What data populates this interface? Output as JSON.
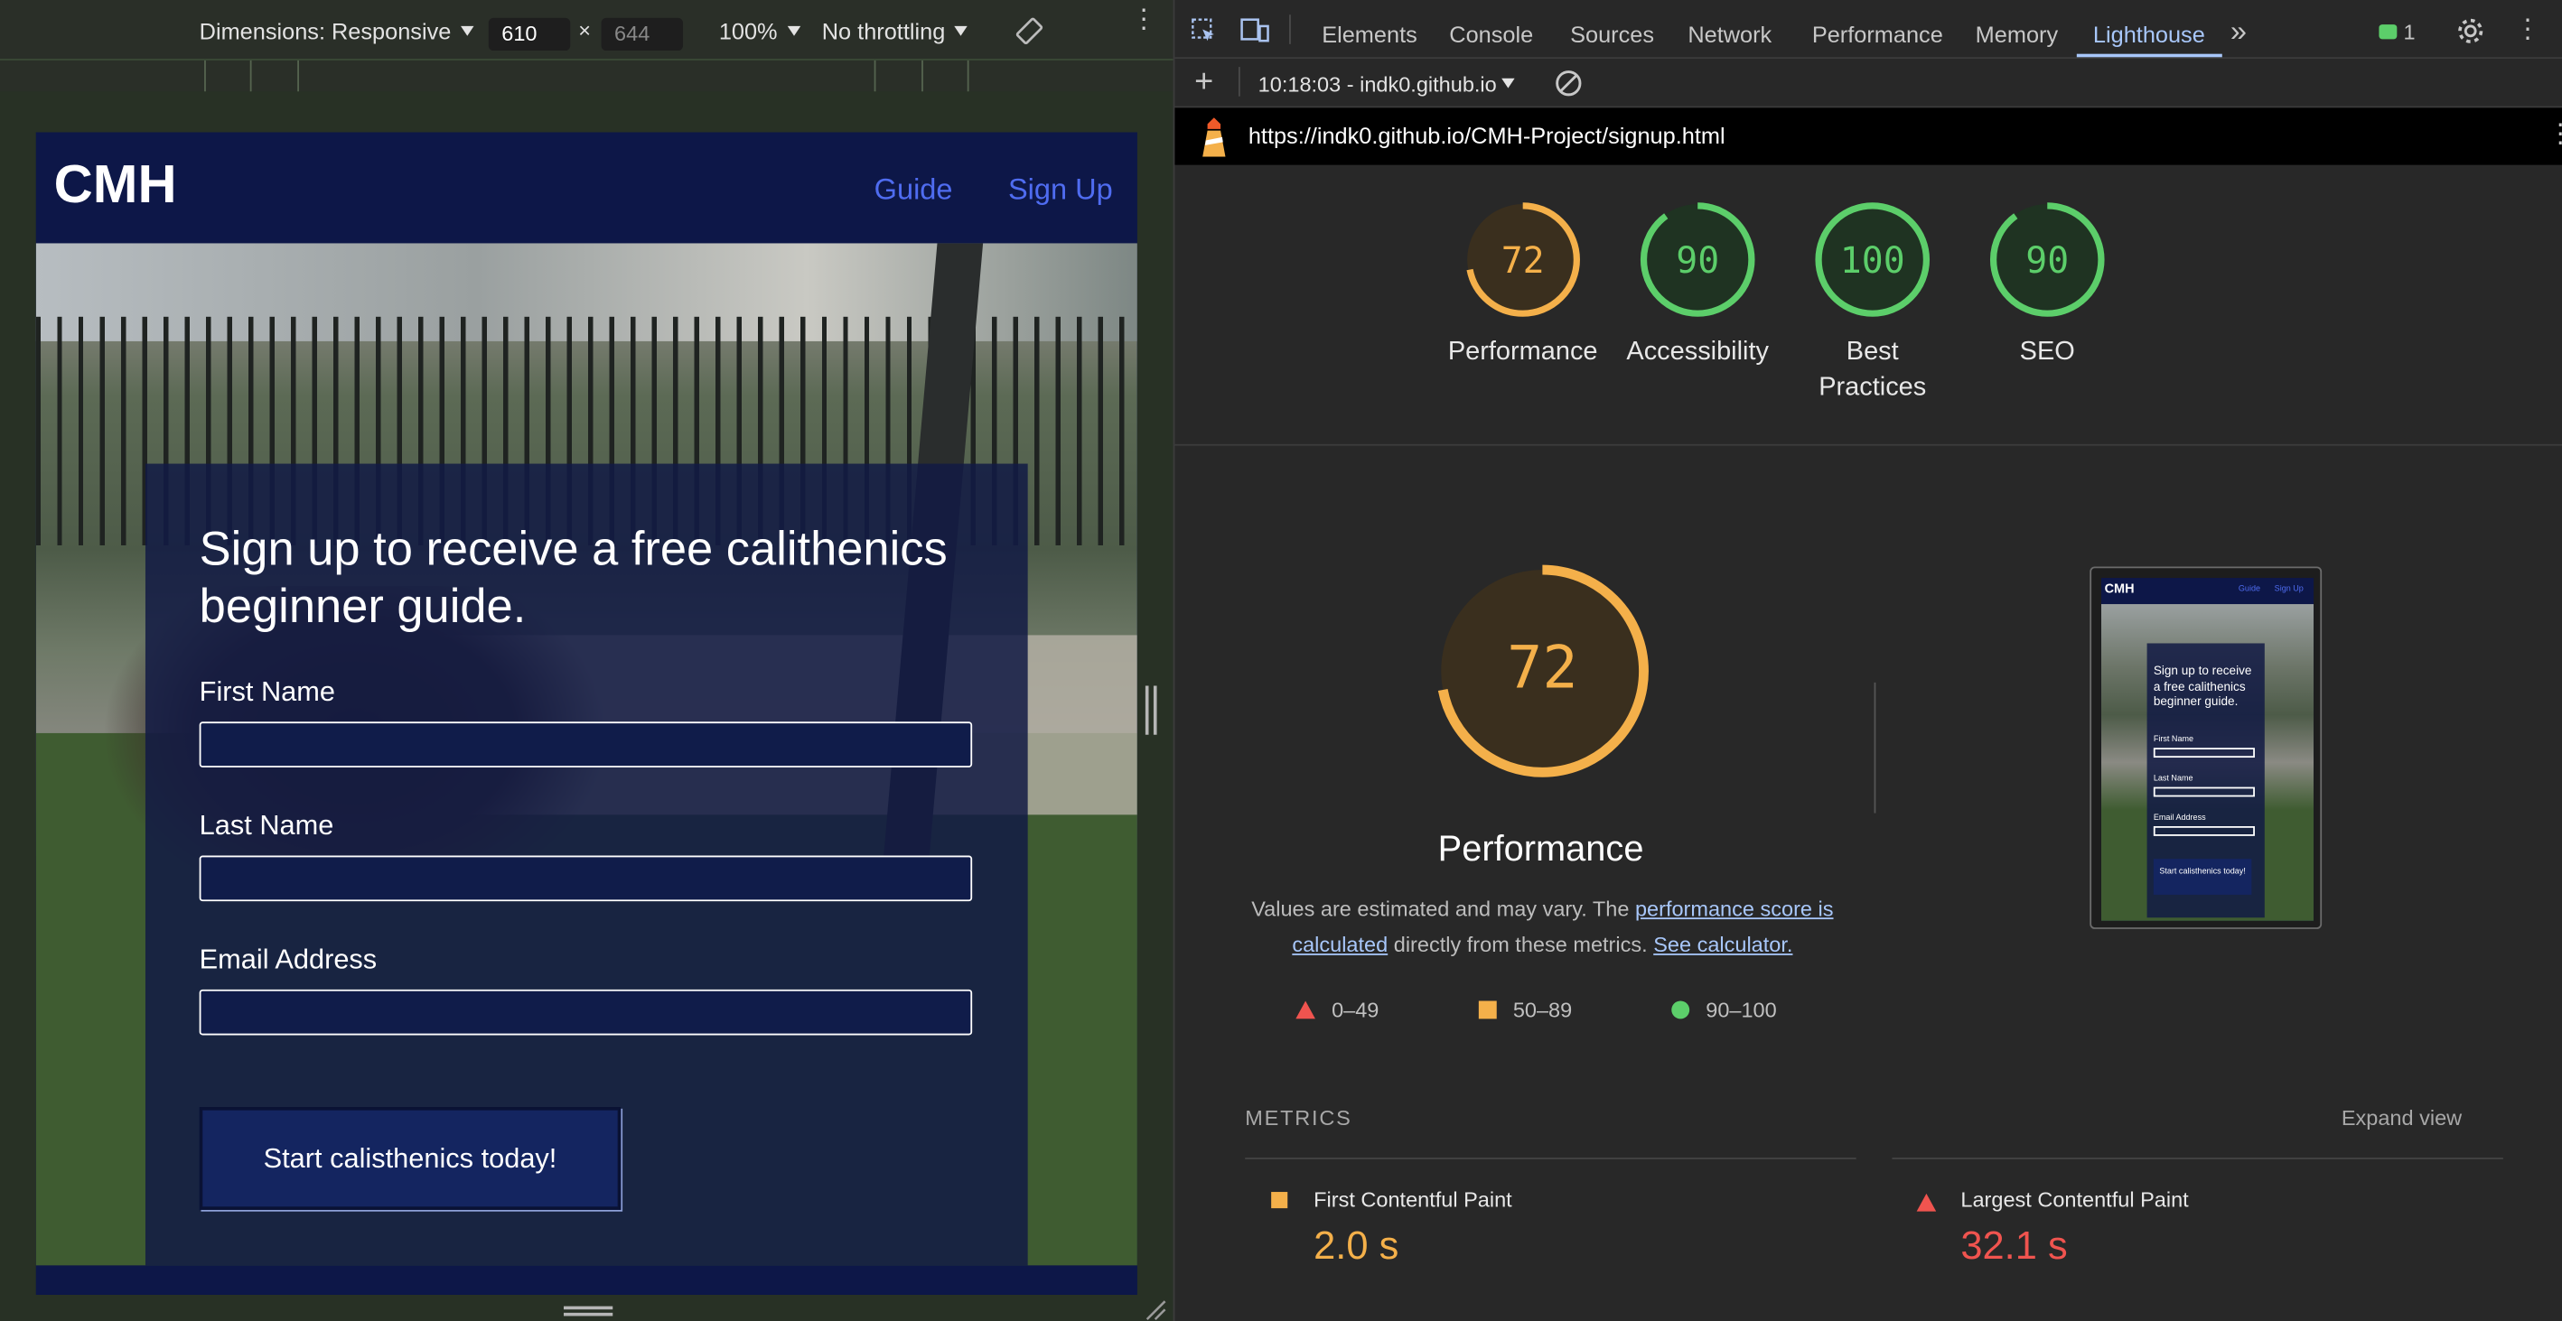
{
  "device_toolbar": {
    "dimensions_label": "Dimensions: Responsive",
    "width": "610",
    "times": "×",
    "height": "644",
    "zoom": "100%",
    "throttling": "No throttling"
  },
  "page": {
    "logo": "CMH",
    "nav": [
      "Guide",
      "Sign Up"
    ],
    "heading": "Sign up to receive a free calithenics beginner guide.",
    "fields": [
      "First Name",
      "Last Name",
      "Email Address"
    ],
    "button": "Start calisthenics today!"
  },
  "devtools": {
    "tabs": [
      "Elements",
      "Console",
      "Sources",
      "Network",
      "Performance",
      "Memory",
      "Lighthouse"
    ],
    "issues_count": "1",
    "report_time": "10:18:03 - indk0.github.io",
    "url": "https://indk0.github.io/CMH-Project/signup.html"
  },
  "scores": [
    {
      "value": "72",
      "label": "Performance",
      "color": "#f4b04a"
    },
    {
      "value": "90",
      "label": "Accessibility",
      "color": "#5cce6a"
    },
    {
      "value": "100",
      "label": "Best Practices",
      "color": "#5cce6a"
    },
    {
      "value": "90",
      "label": "SEO",
      "color": "#5cce6a"
    }
  ],
  "performance": {
    "score": "72",
    "score_fraction": 0.72,
    "title": "Performance",
    "desc_start": "Values are estimated and may vary. The ",
    "link1": "performance score is calculated",
    "desc_mid": " directly from these metrics. ",
    "link2": "See calculator.",
    "legend": [
      "0–49",
      "50–89",
      "90–100"
    ]
  },
  "metrics": {
    "header": "METRICS",
    "expand": "Expand view",
    "items": [
      {
        "name": "First Contentful Paint",
        "value": "2.0 s",
        "color": "#f4b04a"
      },
      {
        "name": "Largest Contentful Paint",
        "value": "32.1 s",
        "color": "#f0544f"
      }
    ]
  },
  "thumbnail": {
    "logo": "CMH",
    "nav": [
      "Guide",
      "Sign Up"
    ],
    "heading": "Sign up to receive a free calithenics beginner guide.",
    "fields": [
      "First Name",
      "Last Name",
      "Email Address"
    ],
    "button": "Start calisthenics today!"
  }
}
